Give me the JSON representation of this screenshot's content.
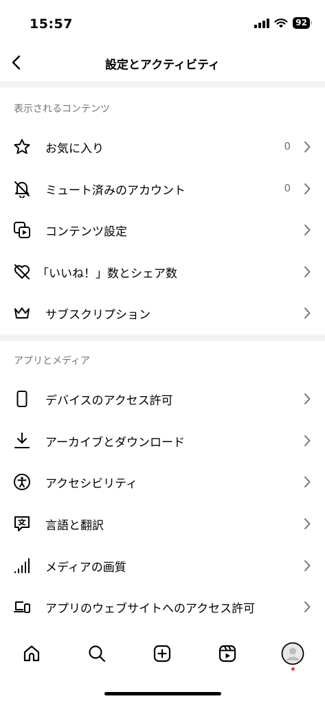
{
  "status_bar": {
    "time": "15:57",
    "battery": "92"
  },
  "header": {
    "title": "設定とアクティビティ"
  },
  "sections": [
    {
      "title": "表示されるコンテンツ",
      "items": [
        {
          "icon": "star-icon",
          "label": "お気に入り",
          "count": "0"
        },
        {
          "icon": "muted-bell-icon",
          "label": "ミュート済みのアカウント",
          "count": "0"
        },
        {
          "icon": "content-settings-icon",
          "label": "コンテンツ設定"
        },
        {
          "icon": "hidden-heart-icon",
          "label": "「いいね！」数とシェア数"
        },
        {
          "icon": "crown-icon",
          "label": "サブスクリプション"
        }
      ]
    },
    {
      "title": "アプリとメディア",
      "items": [
        {
          "icon": "phone-icon",
          "label": "デバイスのアクセス許可"
        },
        {
          "icon": "download-icon",
          "label": "アーカイブとダウンロード"
        },
        {
          "icon": "accessibility-icon",
          "label": "アクセシビリティ"
        },
        {
          "icon": "translate-icon",
          "label": "言語と翻訳"
        },
        {
          "icon": "signal-bars-icon",
          "label": "メディアの画質"
        },
        {
          "icon": "laptop-phone-icon",
          "label": "アプリのウェブサイトへのアクセス許可"
        }
      ]
    }
  ],
  "tab_bar": [
    "home-icon",
    "search-icon",
    "create-icon",
    "reels-icon",
    "profile-icon"
  ]
}
